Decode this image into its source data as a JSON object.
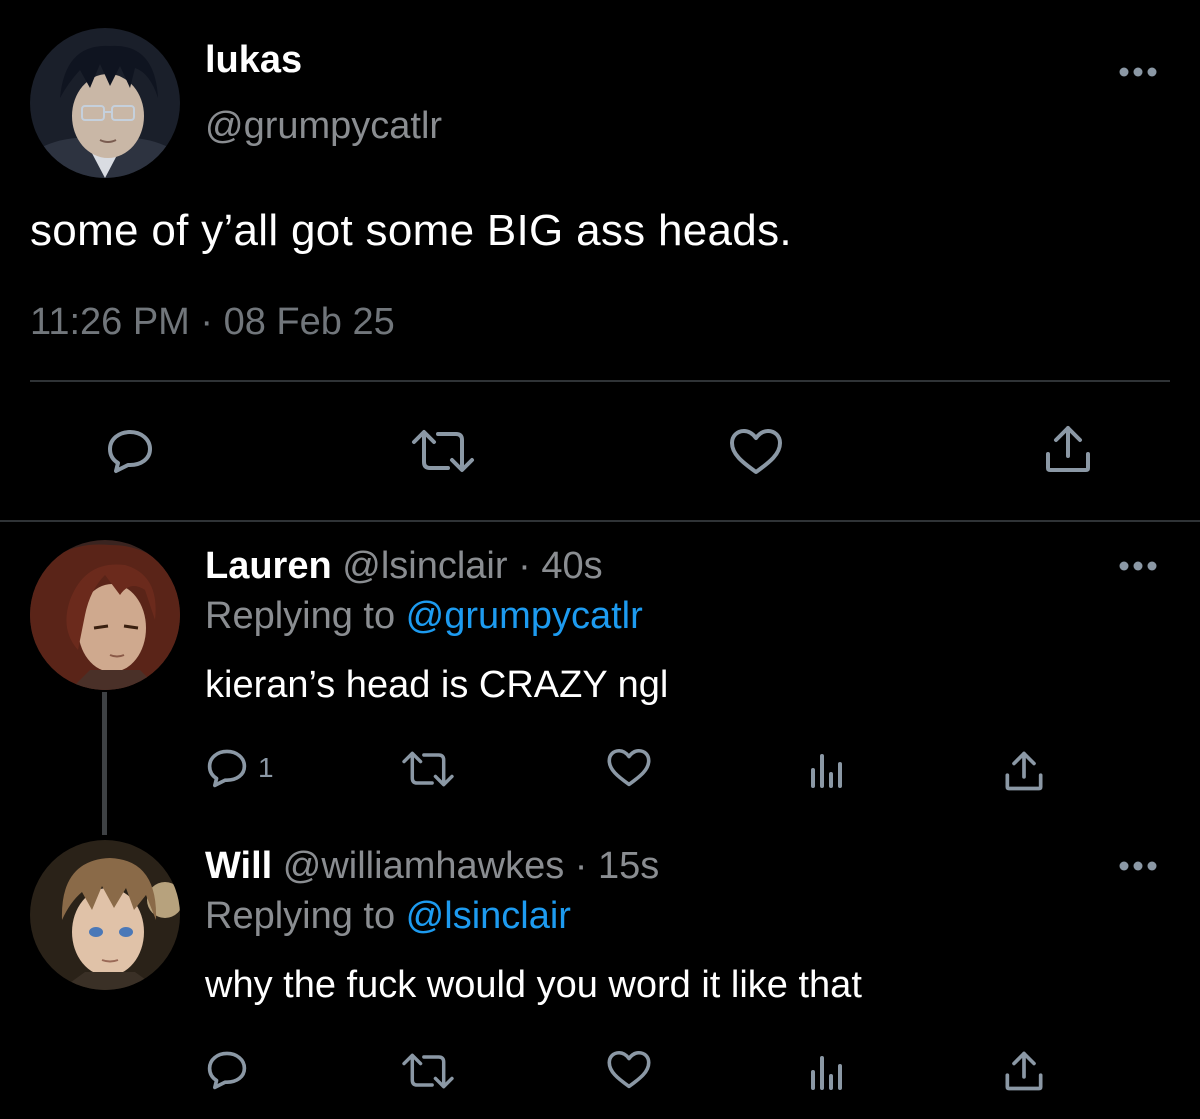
{
  "main_tweet": {
    "display_name": "lukas",
    "handle": "@grumpycatlr",
    "text": "some of y’all got some BIG ass heads.",
    "timestamp": "11:26 PM · 08 Feb 25",
    "avatar_icon": "anime-avatar-dark-hair-glasses",
    "actions": [
      "reply-icon",
      "retweet-icon",
      "like-icon",
      "share-icon"
    ]
  },
  "replies": [
    {
      "display_name": "Lauren",
      "handle": "@lsinclair",
      "time_sep": " · ",
      "time": "40s",
      "replying_prefix": "Replying to ",
      "replying_to": "@grumpycatlr",
      "text": "kieran’s head is CRAZY ngl",
      "reply_count": "1",
      "avatar_icon": "anime-avatar-red-hair"
    },
    {
      "display_name": "Will",
      "handle": "@williamhawkes",
      "time_sep": " · ",
      "time": "15s",
      "replying_prefix": "Replying to ",
      "replying_to": "@lsinclair",
      "text": "why the fuck would you word it like that",
      "reply_count": "",
      "avatar_icon": "anime-avatar-brown-hair"
    }
  ],
  "colors": {
    "background": "#000000",
    "text": "#ffffff",
    "secondary": "#8a8d91",
    "icon": "#8b98a5",
    "link": "#1d9bf0",
    "divider": "#2f3336"
  }
}
